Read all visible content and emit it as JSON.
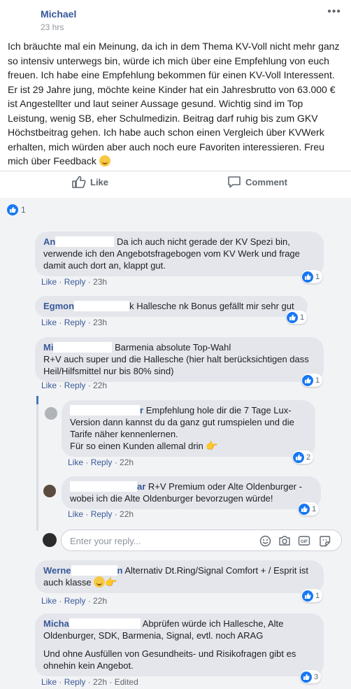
{
  "post": {
    "author": "Michael",
    "time": "23 hrs",
    "more_icon": "more-dots-icon",
    "text_p1": "Ich bräuchte mal ein Meinung, da ich in dem Thema KV-Voll nicht mehr ganz so intensiv unterwegs bin, würde ich mich über eine Empfehlung von euch freuen. Ich habe eine Empfehlung bekommen für einen KV-Voll Interessent. Er ist 29 Jahre jung, möchte keine Kinder hat ein Jahresbrutto von 63.000 € ist Angestellter und laut seiner Aussage gesund. Wichtig sind im Top Leistung, wenig SB, eher Schulmedizin. Beitrag darf ruhig bis zum GKV Höchstbeitrag gehen. Ich habe auch schon einen Vergleich über KVWerk erhalten, mich würden aber auch noch eure Favoriten interessieren. Freu mich über Feedback",
    "emoji": "smiley-emoji"
  },
  "actions": {
    "like_label": "Like",
    "comment_label": "Comment"
  },
  "summary": {
    "count": "1"
  },
  "comments": [
    {
      "name": "An",
      "text": "Da ich auch nicht gerade der KV Spezi bin, verwende ich den Angebotsfragebogen vom KV Werk und frage damit auch dort an, klappt gut.",
      "like": "Like",
      "reply": "Reply",
      "time": "23h",
      "reactions": "1"
    },
    {
      "name": "Egmon",
      "text_tail": "k",
      "text": "Hallesche nk Bonus gefällt mir sehr gut",
      "like": "Like",
      "reply": "Reply",
      "time": "23h",
      "reactions": "1"
    },
    {
      "name": "Mi",
      "text": "Barmenia absolute Top-Wahl",
      "text2": "R+V auch super und die Hallesche (hier halt berücksichtigen dass Heil/Hilfsmittel nur bis 80% sind)",
      "like": "Like",
      "reply": "Reply",
      "time": "22h",
      "reactions": "1"
    },
    {
      "name_tail": "r",
      "text": "Empfehlung hole dir die 7 Tage Lux-Version dann kannst du da ganz gut rumspielen und die Tarife näher kennenlernen.",
      "text2": "Für so einen Kunden allemal drin",
      "like": "Like",
      "reply": "Reply",
      "time": "22h",
      "reactions": "2"
    },
    {
      "name_tail": "ar",
      "text": "R+V Premium oder Alte Oldenburger - wobei ich die Alte Oldenburger bevorzugen würde!",
      "like": "Like",
      "reply": "Reply",
      "time": "22h",
      "reactions": "1"
    },
    {
      "name": "Werne",
      "name_tail": "n",
      "text": "Alternativ Dt.Ring/Signal Comfort + / Esprit ist auch klasse",
      "like": "Like",
      "reply": "Reply",
      "time": "22h",
      "reactions": "1"
    },
    {
      "name": "Micha",
      "text": "Abprüfen würde ich Hallesche, Alte Oldenburger, SDK, Barmenia, Signal, evtl. noch ARAG",
      "text2": "Und ohne Ausfüllen von Gesundheits- und Risikofragen gibt es ohnehin kein Angebot.",
      "like": "Like",
      "reply": "Reply",
      "time": "22h",
      "edited": "Edited",
      "reactions": "3"
    }
  ],
  "reply_box": {
    "placeholder": "Enter your reply...",
    "icons": [
      "emoji-icon",
      "camera-icon",
      "gif-icon",
      "sticker-icon"
    ]
  },
  "colors": {
    "link": "#385898",
    "like_blue": "#1877f2",
    "bubble": "#e4e6eb",
    "background": "#f2f3f5"
  }
}
